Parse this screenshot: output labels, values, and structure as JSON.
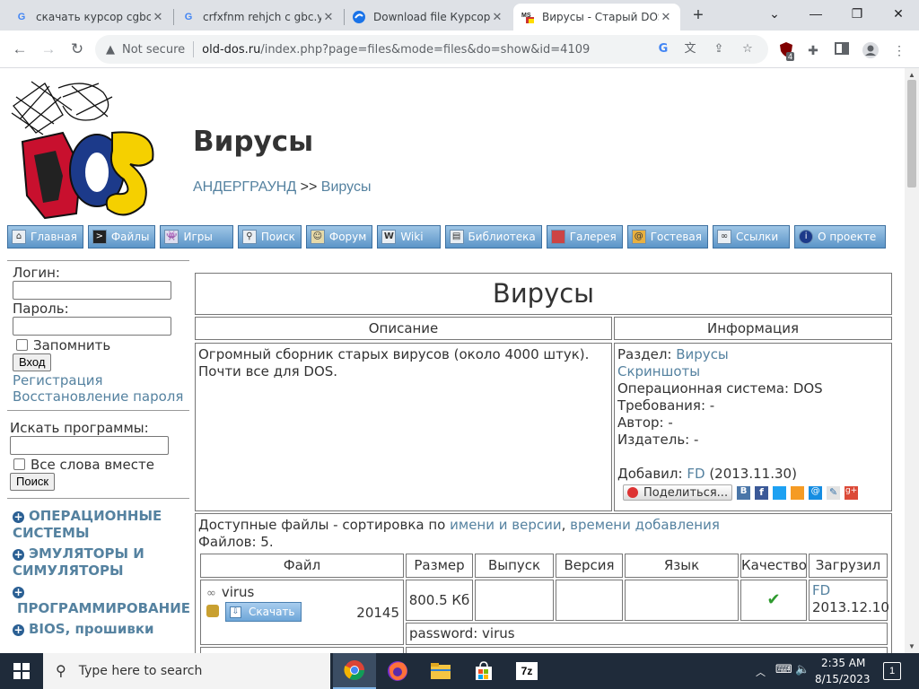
{
  "browser": {
    "tabs": [
      {
        "title": "скачать курсор cgbc.",
        "icon": "google-icon"
      },
      {
        "title": "crfxfnm rehjch c gbc.yj",
        "icon": "google-icon"
      },
      {
        "title": "Download file Курсор -",
        "icon": "download-site-icon"
      },
      {
        "title": "Вирусы - Старый DOS",
        "icon": "msdos-favicon",
        "active": true
      }
    ],
    "new_tab": "+",
    "security_label": "Not secure",
    "url_host": "old-dos.ru",
    "url_path": "/index.php?page=files&mode=files&do=show&id=4109",
    "ext_badge": "4"
  },
  "site": {
    "logo_alt": "MS DOS",
    "page_title": "Вирусы",
    "breadcrumb": {
      "root": "АНДЕРГРАУНД",
      "sep": ">>",
      "current": "Вирусы"
    },
    "nav": [
      {
        "label": "Главная",
        "icon": "home-icon"
      },
      {
        "label": "Файлы",
        "icon": "terminal-icon"
      },
      {
        "label": "Игры",
        "icon": "invader-icon"
      },
      {
        "label": "Поиск",
        "icon": "magnifier-icon"
      },
      {
        "label": "Форум",
        "icon": "user-icon"
      },
      {
        "label": "Wiki",
        "icon": "wiki-icon"
      },
      {
        "label": "Библиотека",
        "icon": "book-icon"
      },
      {
        "label": "Галерея",
        "icon": "picture-icon"
      },
      {
        "label": "Гостевая",
        "icon": "guestbook-icon"
      },
      {
        "label": "Ссылки",
        "icon": "link-icon"
      },
      {
        "label": "О проекте",
        "icon": "info-icon"
      }
    ]
  },
  "sidebar": {
    "login_label": "Логин:",
    "password_label": "Пароль:",
    "remember_label": "Запомнить",
    "login_button": "Вход",
    "register_link": "Регистрация",
    "restore_link": "Восстановление пароля",
    "search_label": "Искать программы:",
    "all_words_label": "Все слова вместе",
    "search_button": "Поиск",
    "categories": [
      {
        "line1": "ОПЕРАЦИОННЫЕ",
        "line2": "СИСТЕМЫ"
      },
      {
        "line1": "ЭМУЛЯТОРЫ И",
        "line2": "СИМУЛЯТОРЫ"
      },
      {
        "line1": "",
        "line2": "ПРОГРАММИРОВАНИЕ"
      },
      {
        "line1": "BIOS, прошивки",
        "line2": ""
      }
    ]
  },
  "main": {
    "title": "Вирусы",
    "desc_header": "Описание",
    "info_header": "Информация",
    "description": [
      "Огромный сборник старых вирусов (около 4000 штук).",
      "Почти все для DOS."
    ],
    "info": {
      "section_label": "Раздел:",
      "section_value": "Вирусы",
      "screenshots": "Скриншоты",
      "os": "Операционная система: DOS",
      "requirements": "Требования: -",
      "author": "Автор: -",
      "publisher": "Издатель: -",
      "added_label": "Добавил:",
      "added_user": "FD",
      "added_date": "(2013.11.30)",
      "share_label": "Поделиться..."
    },
    "files": {
      "available_prefix": "Доступные файлы - сортировка по",
      "sort_name": "имени и версии",
      "comma": ",",
      "sort_time": "времени добавления",
      "count": "Файлов: 5.",
      "columns": [
        "Файл",
        "Размер",
        "Выпуск",
        "Версия",
        "Язык",
        "Качество",
        "Загрузил"
      ],
      "rows": [
        {
          "name": "virus",
          "download_label": "Скачать",
          "downloads": "20145",
          "size": "800.5 Кб",
          "release": "",
          "version": "",
          "language": "",
          "quality_icon": "checkmark-icon",
          "uploader": "FD",
          "upload_date": "2013.12.10",
          "note": "password: virus"
        }
      ]
    }
  },
  "taskbar": {
    "search_placeholder": "Type here to search",
    "time": "2:35 AM",
    "date": "8/15/2023",
    "notifications": "1"
  }
}
